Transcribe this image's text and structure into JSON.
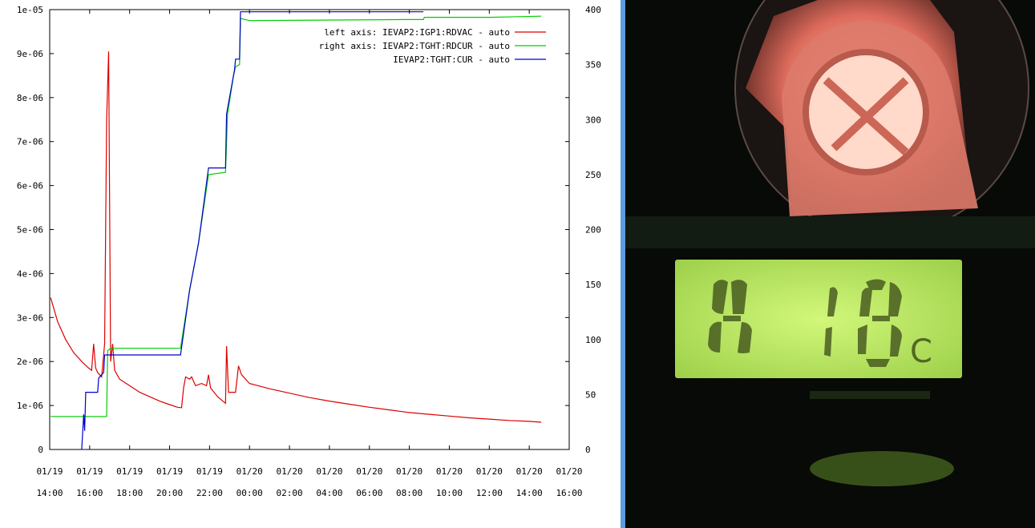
{
  "chart_data": {
    "type": "line",
    "title": "",
    "xlabel": "",
    "ylabel": "",
    "x_ticks": [
      {
        "date": "01/19",
        "time": "14:00",
        "h": 14
      },
      {
        "date": "01/19",
        "time": "16:00",
        "h": 16
      },
      {
        "date": "01/19",
        "time": "18:00",
        "h": 18
      },
      {
        "date": "01/19",
        "time": "20:00",
        "h": 20
      },
      {
        "date": "01/19",
        "time": "22:00",
        "h": 22
      },
      {
        "date": "01/20",
        "time": "00:00",
        "h": 24
      },
      {
        "date": "01/20",
        "time": "02:00",
        "h": 26
      },
      {
        "date": "01/20",
        "time": "04:00",
        "h": 28
      },
      {
        "date": "01/20",
        "time": "06:00",
        "h": 30
      },
      {
        "date": "01/20",
        "time": "08:00",
        "h": 32
      },
      {
        "date": "01/20",
        "time": "10:00",
        "h": 34
      },
      {
        "date": "01/20",
        "time": "12:00",
        "h": 36
      },
      {
        "date": "01/20",
        "time": "14:00",
        "h": 38
      },
      {
        "date": "01/20",
        "time": "16:00",
        "h": 40
      }
    ],
    "xlim_hours": [
      14,
      40
    ],
    "left_axis": {
      "ylim": [
        0,
        1e-05
      ],
      "ticks": [
        {
          "v": 0,
          "label": "0"
        },
        {
          "v": 1e-06,
          "label": "1e-06"
        },
        {
          "v": 2e-06,
          "label": "2e-06"
        },
        {
          "v": 3e-06,
          "label": "3e-06"
        },
        {
          "v": 4e-06,
          "label": "4e-06"
        },
        {
          "v": 5e-06,
          "label": "5e-06"
        },
        {
          "v": 6e-06,
          "label": "6e-06"
        },
        {
          "v": 7e-06,
          "label": "7e-06"
        },
        {
          "v": 8e-06,
          "label": "8e-06"
        },
        {
          "v": 9e-06,
          "label": "9e-06"
        },
        {
          "v": 1e-05,
          "label": "1e-05"
        }
      ]
    },
    "right_axis": {
      "ylim": [
        0,
        400
      ],
      "ticks": [
        {
          "v": 0,
          "label": "0"
        },
        {
          "v": 50,
          "label": "50"
        },
        {
          "v": 100,
          "label": "100"
        },
        {
          "v": 150,
          "label": "150"
        },
        {
          "v": 200,
          "label": "200"
        },
        {
          "v": 250,
          "label": "250"
        },
        {
          "v": 300,
          "label": "300"
        },
        {
          "v": 350,
          "label": "350"
        },
        {
          "v": 400,
          "label": "400"
        }
      ]
    },
    "grid": false,
    "legend_position": "top-right",
    "series": [
      {
        "name": "left axis: IEVAP2:IGP1:RDVAC  - auto",
        "axis": "left",
        "color": "#dd0000",
        "points": [
          [
            14.05,
            3.45e-06
          ],
          [
            14.4,
            2.9e-06
          ],
          [
            14.8,
            2.5e-06
          ],
          [
            15.2,
            2.2e-06
          ],
          [
            15.6,
            2e-06
          ],
          [
            15.95,
            1.85e-06
          ],
          [
            16.1,
            1.8e-06
          ],
          [
            16.2,
            2.4e-06
          ],
          [
            16.3,
            1.85e-06
          ],
          [
            16.4,
            1.75e-06
          ],
          [
            16.6,
            1.65e-06
          ],
          [
            16.75,
            2.4e-06
          ],
          [
            16.85,
            7.5e-06
          ],
          [
            16.95,
            9.05e-06
          ],
          [
            17.05,
            2e-06
          ],
          [
            17.15,
            2.4e-06
          ],
          [
            17.25,
            1.8e-06
          ],
          [
            17.5,
            1.6e-06
          ],
          [
            18.0,
            1.45e-06
          ],
          [
            18.5,
            1.3e-06
          ],
          [
            19.0,
            1.2e-06
          ],
          [
            19.5,
            1.1e-06
          ],
          [
            20.0,
            1.02e-06
          ],
          [
            20.4,
            9.6e-07
          ],
          [
            20.6,
            9.5e-07
          ],
          [
            20.7,
            1.4e-06
          ],
          [
            20.8,
            1.65e-06
          ],
          [
            21.0,
            1.6e-06
          ],
          [
            21.1,
            1.65e-06
          ],
          [
            21.3,
            1.45e-06
          ],
          [
            21.6,
            1.5e-06
          ],
          [
            21.85,
            1.45e-06
          ],
          [
            21.95,
            1.7e-06
          ],
          [
            22.05,
            1.4e-06
          ],
          [
            22.4,
            1.2e-06
          ],
          [
            22.8,
            1.05e-06
          ],
          [
            22.85,
            2.35e-06
          ],
          [
            22.95,
            1.3e-06
          ],
          [
            23.3,
            1.3e-06
          ],
          [
            23.45,
            1.9e-06
          ],
          [
            23.6,
            1.7e-06
          ],
          [
            24.0,
            1.5e-06
          ],
          [
            25.0,
            1.38e-06
          ],
          [
            26.0,
            1.28e-06
          ],
          [
            27.0,
            1.18e-06
          ],
          [
            28.0,
            1.1e-06
          ],
          [
            29.0,
            1.03e-06
          ],
          [
            30.0,
            9.6e-07
          ],
          [
            31.0,
            9e-07
          ],
          [
            32.0,
            8.4e-07
          ],
          [
            33.0,
            8e-07
          ],
          [
            34.0,
            7.6e-07
          ],
          [
            35.0,
            7.2e-07
          ],
          [
            36.0,
            6.9e-07
          ],
          [
            37.0,
            6.6e-07
          ],
          [
            38.0,
            6.4e-07
          ],
          [
            38.6,
            6.2e-07
          ]
        ]
      },
      {
        "name": "right axis: IEVAP2:TGHT:RDCUR  - auto",
        "axis": "right",
        "color": "#00cc00",
        "points": [
          [
            14.05,
            30
          ],
          [
            15.8,
            30
          ],
          [
            16.85,
            30
          ],
          [
            16.9,
            90
          ],
          [
            17.05,
            92
          ],
          [
            20.5,
            92
          ],
          [
            20.55,
            92
          ],
          [
            21.0,
            145
          ],
          [
            21.45,
            188
          ],
          [
            21.95,
            250
          ],
          [
            22.8,
            252
          ],
          [
            22.9,
            305
          ],
          [
            23.2,
            340
          ],
          [
            23.3,
            348
          ],
          [
            23.5,
            350
          ],
          [
            23.55,
            392
          ],
          [
            24.0,
            390
          ],
          [
            32.0,
            391
          ],
          [
            32.7,
            391
          ],
          [
            32.75,
            393
          ],
          [
            36.0,
            393
          ],
          [
            38.6,
            394
          ]
        ]
      },
      {
        "name": "IEVAP2:TGHT:CUR  - auto",
        "axis": "right",
        "color": "#0000cc",
        "points": [
          [
            15.6,
            0
          ],
          [
            15.65,
            15
          ],
          [
            15.7,
            32
          ],
          [
            15.75,
            17
          ],
          [
            15.8,
            52
          ],
          [
            16.4,
            52
          ],
          [
            16.45,
            65
          ],
          [
            16.7,
            70
          ],
          [
            16.75,
            86
          ],
          [
            20.5,
            86
          ],
          [
            20.55,
            86
          ],
          [
            21.0,
            145
          ],
          [
            21.45,
            188
          ],
          [
            21.95,
            256
          ],
          [
            22.8,
            256
          ],
          [
            22.85,
            305
          ],
          [
            23.25,
            345
          ],
          [
            23.3,
            355
          ],
          [
            23.5,
            355
          ],
          [
            23.55,
            398
          ],
          [
            24.0,
            398
          ],
          [
            32.7,
            398
          ]
        ]
      }
    ]
  },
  "photo": {
    "description_label": "",
    "display_digits": "",
    "display_unit": "C",
    "display_color": "#b6ec5a",
    "glow_color": "#ff7a6a"
  }
}
